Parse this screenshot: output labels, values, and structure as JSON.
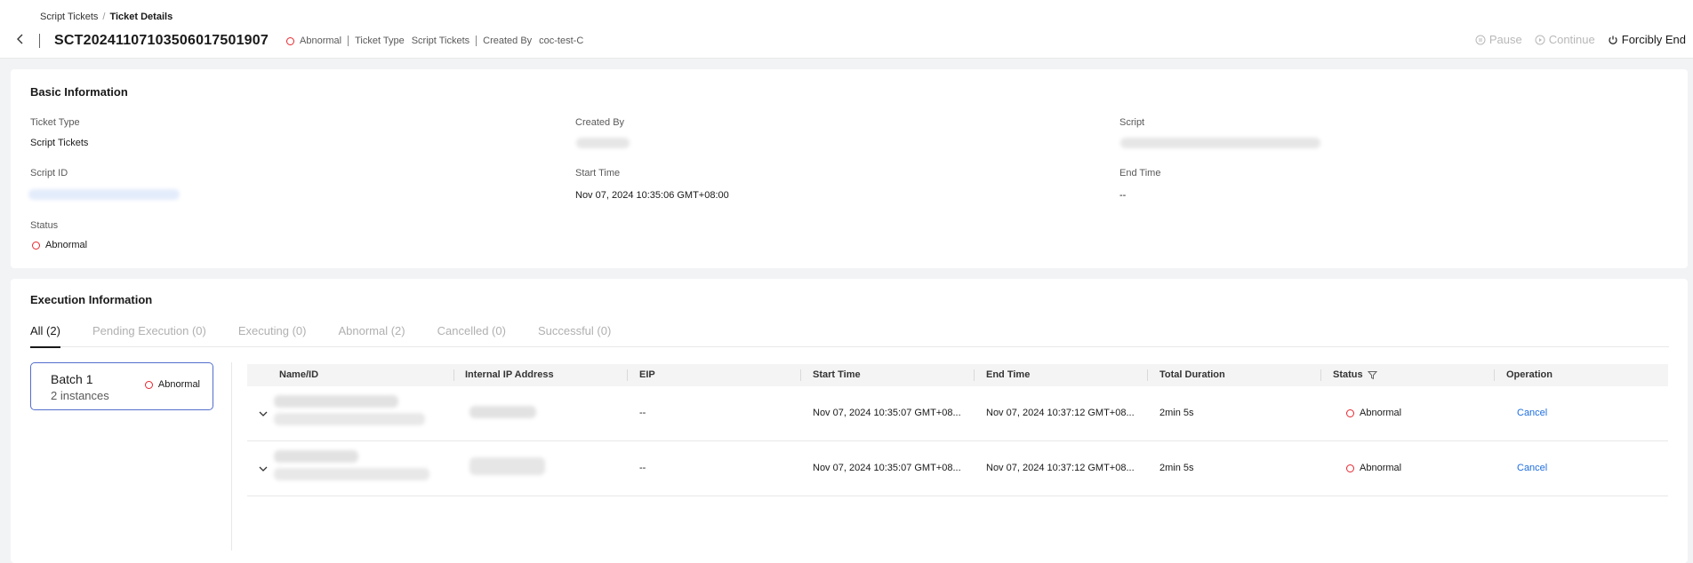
{
  "breadcrumb": {
    "parent": "Script Tickets",
    "separator": "/",
    "current": "Ticket Details"
  },
  "ticket": {
    "id": "SCT20241107103506017501907",
    "status": "Abnormal",
    "type_label": "Ticket Type",
    "type_value": "Script Tickets",
    "created_by_label": "Created By",
    "created_by_value": "coc-test-C"
  },
  "actions": {
    "pause": "Pause",
    "continue": "Continue",
    "forcibly_end": "Forcibly End"
  },
  "basic": {
    "title": "Basic Information",
    "ticket_type_label": "Ticket Type",
    "ticket_type_value": "Script Tickets",
    "created_by_label": "Created By",
    "script_label": "Script",
    "script_id_label": "Script ID",
    "start_time_label": "Start Time",
    "start_time_value": "Nov 07, 2024 10:35:06 GMT+08:00",
    "end_time_label": "End Time",
    "end_time_value": "--",
    "status_label": "Status",
    "status_value": "Abnormal"
  },
  "execution": {
    "title": "Execution Information",
    "tabs": [
      {
        "label": "All (2)",
        "active": true
      },
      {
        "label": "Pending Execution (0)",
        "active": false
      },
      {
        "label": "Executing (0)",
        "active": false
      },
      {
        "label": "Abnormal (2)",
        "active": false
      },
      {
        "label": "Cancelled (0)",
        "active": false
      },
      {
        "label": "Successful (0)",
        "active": false
      }
    ],
    "batch": {
      "name": "Batch 1",
      "count": "2 instances",
      "status": "Abnormal"
    },
    "columns": [
      "Name/ID",
      "Internal IP Address",
      "EIP",
      "Start Time",
      "End Time",
      "Total Duration",
      "Status",
      "Operation"
    ],
    "rows": [
      {
        "eip": "--",
        "start": "Nov 07, 2024 10:35:07 GMT+08...",
        "end": "Nov 07, 2024 10:37:12 GMT+08...",
        "duration": "2min 5s",
        "status": "Abnormal",
        "operation": "Cancel"
      },
      {
        "eip": "--",
        "start": "Nov 07, 2024 10:35:07 GMT+08...",
        "end": "Nov 07, 2024 10:37:12 GMT+08...",
        "duration": "2min 5s",
        "status": "Abnormal",
        "operation": "Cancel"
      }
    ]
  },
  "colors": {
    "accent": "#526ecc",
    "link": "#1d6ee0",
    "error": "#e6262d"
  }
}
